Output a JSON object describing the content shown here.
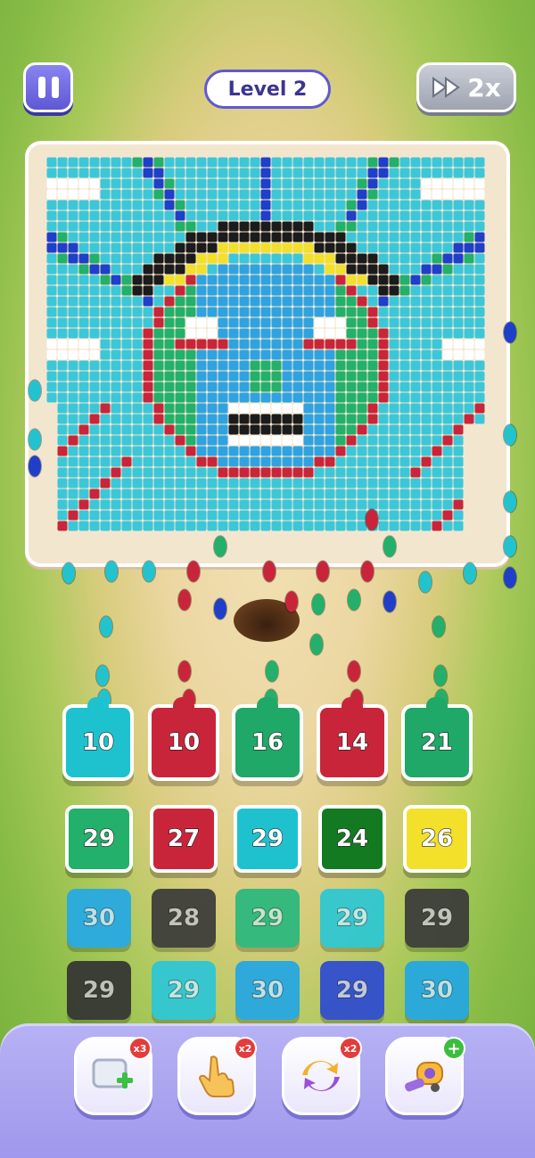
{
  "header": {
    "level_label": "Level 2",
    "speed_label": "2x"
  },
  "icons": {
    "pause": "pause-icon",
    "speed": "fast-forward-icon",
    "add_slot": "add-tile-icon",
    "tap": "hand-tap-icon",
    "shuffle": "shuffle-icon",
    "vacuum": "vacuum-icon"
  },
  "slots": [
    {
      "value": "10",
      "color": "#1ec2cf"
    },
    {
      "value": "10",
      "color": "#c9253a"
    },
    {
      "value": "16",
      "color": "#1fa867"
    },
    {
      "value": "14",
      "color": "#c9253a"
    },
    {
      "value": "21",
      "color": "#1fa867"
    }
  ],
  "tiles": [
    {
      "value": "29",
      "color": "#22b06a",
      "layer": "front"
    },
    {
      "value": "27",
      "color": "#c9253a",
      "layer": "front"
    },
    {
      "value": "29",
      "color": "#1ec2cf",
      "layer": "front"
    },
    {
      "value": "24",
      "color": "#137a22",
      "layer": "front"
    },
    {
      "value": "26",
      "color": "#f2e02b",
      "layer": "front"
    },
    {
      "value": "30",
      "color": "#24a9e6",
      "layer": "back"
    },
    {
      "value": "28",
      "color": "#3a3a3a",
      "layer": "back"
    },
    {
      "value": "29",
      "color": "#28b87d",
      "layer": "back"
    },
    {
      "value": "29",
      "color": "#2bc7d4",
      "layer": "back"
    },
    {
      "value": "29",
      "color": "#3a3a3a",
      "layer": "back"
    },
    {
      "value": "29",
      "color": "#333333",
      "layer": "back"
    },
    {
      "value": "29",
      "color": "#2cc6d8",
      "layer": "back"
    },
    {
      "value": "30",
      "color": "#22a7e4",
      "layer": "back"
    },
    {
      "value": "29",
      "color": "#2c4bd1",
      "layer": "back"
    },
    {
      "value": "30",
      "color": "#22a7e4",
      "layer": "back"
    }
  ],
  "boosters": [
    {
      "name": "add-slot",
      "count": "x3"
    },
    {
      "name": "tap",
      "count": "x2"
    },
    {
      "name": "shuffle",
      "count": "x2"
    },
    {
      "name": "vacuum",
      "count": "+"
    }
  ],
  "colors": {
    "sky": "#3cc7d8",
    "face": "#2fa3e0",
    "crown_green": "#22b06a",
    "ray_blue": "#1f3fc9",
    "outline_yellow": "#f2e02b",
    "dark": "#1b1b1b",
    "red": "#c9253a",
    "white": "#ffffff"
  }
}
